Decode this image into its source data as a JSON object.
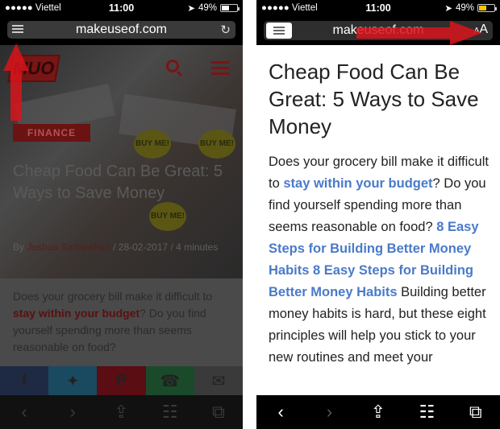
{
  "status": {
    "carrier": "●●●●● Viettel",
    "time": "11:00",
    "battery_pct": "49%",
    "battery_fraction": 0.49
  },
  "left": {
    "url": "makeuseof.com",
    "logo_text": "MUO",
    "category_badge": "FINANCE",
    "buy_me": "BUY ME!",
    "hero_title": "Cheap Food Can Be Great: 5 Ways to Save Money",
    "byline_prefix": "By",
    "author": "Joshua Sarfanshan",
    "date": "/ 28-02-2017",
    "read_time": "/ 4 minutes",
    "article": {
      "intro": "Does your grocery bill make it difficult to ",
      "link": "stay within your budget",
      "rest": "? Do you find yourself spending more than seems reasonable on food?"
    },
    "share": [
      {
        "name": "facebook-share-button",
        "glyph": "f",
        "color": "#1e2a44"
      },
      {
        "name": "twitter-share-button",
        "glyph": "✦",
        "color": "#1a4a60"
      },
      {
        "name": "pinterest-share-button",
        "glyph": "P",
        "color": "#5a0d12"
      },
      {
        "name": "whatsapp-share-button",
        "glyph": "☎",
        "color": "#1a4a2a"
      },
      {
        "name": "email-share-button",
        "glyph": "✉",
        "color": "#3a3a3a"
      }
    ]
  },
  "right": {
    "url": "makeuseof.com",
    "aa_small": "A",
    "aa_large": "A",
    "title": "Cheap Food Can Be Great: 5 Ways to Save Money",
    "body": {
      "t1": "Does your grocery bill make it difficult to ",
      "l1": "stay within your budget",
      "t2": "? Do you find yourself spending more than seems reasonable on food? ",
      "l2": "8 Easy Steps for Building Better Money Habits",
      "t3": " ",
      "l3": "8 Easy Steps for Building Better Money Habits",
      "t4": " Building better money habits is hard, but these eight principles will help you stick to your new routines and meet your"
    }
  },
  "toolbar": {
    "back": "‹",
    "forward": "›",
    "share": "⇪",
    "bookmarks": "☷",
    "tabs": "⧉"
  },
  "colors": {
    "arrow_red": "#d8141b",
    "link_blue": "#4a7ac9"
  }
}
